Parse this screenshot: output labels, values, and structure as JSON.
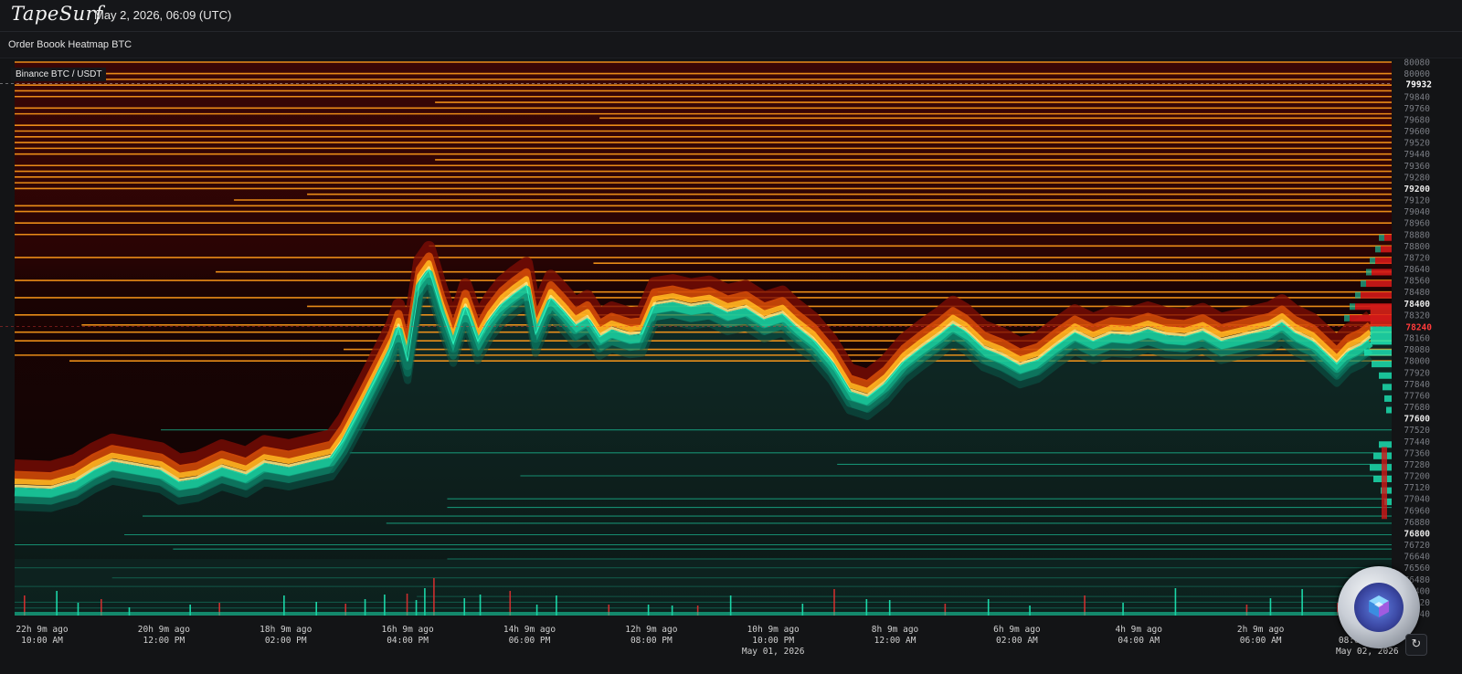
{
  "app": {
    "brand": "TapeSurf",
    "datetime": "May 2, 2026, 06:09 (UTC)"
  },
  "page": {
    "title": "Order Boook Heatmap BTC"
  },
  "chart_data": {
    "type": "heatmap",
    "title": "Binance BTC / USDT",
    "ylim": [
      76240,
      80080
    ],
    "y_ticks": [
      {
        "v": 80080,
        "label": "80080",
        "bold": false
      },
      {
        "v": 80000,
        "label": "80000",
        "bold": false
      },
      {
        "v": 79840,
        "label": "79840",
        "bold": false
      },
      {
        "v": 79760,
        "label": "79760",
        "bold": false
      },
      {
        "v": 79680,
        "label": "79680",
        "bold": false
      },
      {
        "v": 79600,
        "label": "79600",
        "bold": false
      },
      {
        "v": 79520,
        "label": "79520",
        "bold": false
      },
      {
        "v": 79440,
        "label": "79440",
        "bold": false
      },
      {
        "v": 79360,
        "label": "79360",
        "bold": false
      },
      {
        "v": 79280,
        "label": "79280",
        "bold": false
      },
      {
        "v": 79200,
        "label": "79200",
        "bold": true
      },
      {
        "v": 79120,
        "label": "79120",
        "bold": false
      },
      {
        "v": 79040,
        "label": "79040",
        "bold": false
      },
      {
        "v": 78960,
        "label": "78960",
        "bold": false
      },
      {
        "v": 78880,
        "label": "78880",
        "bold": false
      },
      {
        "v": 78800,
        "label": "78800",
        "bold": false
      },
      {
        "v": 78720,
        "label": "78720",
        "bold": false
      },
      {
        "v": 78640,
        "label": "78640",
        "bold": false
      },
      {
        "v": 78560,
        "label": "78560",
        "bold": false
      },
      {
        "v": 78480,
        "label": "78480",
        "bold": false
      },
      {
        "v": 78400,
        "label": "78400",
        "bold": true
      },
      {
        "v": 78320,
        "label": "78320",
        "bold": false
      },
      {
        "v": 78160,
        "label": "78160",
        "bold": false
      },
      {
        "v": 78080,
        "label": "78080",
        "bold": false
      },
      {
        "v": 78000,
        "label": "78000",
        "bold": false
      },
      {
        "v": 77920,
        "label": "77920",
        "bold": false
      },
      {
        "v": 77840,
        "label": "77840",
        "bold": false
      },
      {
        "v": 77760,
        "label": "77760",
        "bold": false
      },
      {
        "v": 77680,
        "label": "77680",
        "bold": false
      },
      {
        "v": 77600,
        "label": "77600",
        "bold": true
      },
      {
        "v": 77520,
        "label": "77520",
        "bold": false
      },
      {
        "v": 77440,
        "label": "77440",
        "bold": false
      },
      {
        "v": 77360,
        "label": "77360",
        "bold": false
      },
      {
        "v": 77280,
        "label": "77280",
        "bold": false
      },
      {
        "v": 77200,
        "label": "77200",
        "bold": false
      },
      {
        "v": 77120,
        "label": "77120",
        "bold": false
      },
      {
        "v": 77040,
        "label": "77040",
        "bold": false
      },
      {
        "v": 76960,
        "label": "76960",
        "bold": false
      },
      {
        "v": 76880,
        "label": "76880",
        "bold": false
      },
      {
        "v": 76800,
        "label": "76800",
        "bold": true
      },
      {
        "v": 76720,
        "label": "76720",
        "bold": false
      },
      {
        "v": 76640,
        "label": "76640",
        "bold": false
      },
      {
        "v": 76560,
        "label": "76560",
        "bold": false
      },
      {
        "v": 76480,
        "label": "76480",
        "bold": false
      },
      {
        "v": 76400,
        "label": "76400",
        "bold": false
      },
      {
        "v": 76320,
        "label": "76320",
        "bold": false
      },
      {
        "v": 76240,
        "label": "76240",
        "bold": false
      }
    ],
    "price_markers": [
      {
        "v": 79932,
        "label": "79932",
        "color": "#ffffff"
      },
      {
        "v": 78240,
        "label": "78240",
        "color": "#ff3b3b"
      }
    ],
    "x_ticks": [
      {
        "h": -22.15,
        "line1": "22h 9m ago",
        "line2": "10:00 AM",
        "line3": ""
      },
      {
        "h": -20.15,
        "line1": "20h 9m ago",
        "line2": "12:00 PM",
        "line3": ""
      },
      {
        "h": -18.15,
        "line1": "18h 9m ago",
        "line2": "02:00 PM",
        "line3": ""
      },
      {
        "h": -16.15,
        "line1": "16h 9m ago",
        "line2": "04:00 PM",
        "line3": ""
      },
      {
        "h": -14.15,
        "line1": "14h 9m ago",
        "line2": "06:00 PM",
        "line3": ""
      },
      {
        "h": -12.15,
        "line1": "12h 9m ago",
        "line2": "08:00 PM",
        "line3": ""
      },
      {
        "h": -10.15,
        "line1": "10h 9m ago",
        "line2": "10:00 PM",
        "line3": "May 01, 2026"
      },
      {
        "h": -8.15,
        "line1": "8h 9m ago",
        "line2": "12:00 AM",
        "line3": ""
      },
      {
        "h": -6.15,
        "line1": "6h 9m ago",
        "line2": "02:00 AM",
        "line3": ""
      },
      {
        "h": -4.15,
        "line1": "4h 9m ago",
        "line2": "04:00 AM",
        "line3": ""
      },
      {
        "h": -2.15,
        "line1": "2h 9m ago",
        "line2": "06:00 AM",
        "line3": ""
      },
      {
        "h": -0.4,
        "line1": "",
        "line2": "08:09:00 AM",
        "line3": "May 02, 2026"
      },
      {
        "h": 0,
        "line1": "now",
        "line2": "",
        "line3": ""
      }
    ],
    "price_series": [
      [
        -22.6,
        77130
      ],
      [
        -22.0,
        77120
      ],
      [
        -21.6,
        77170
      ],
      [
        -21.3,
        77250
      ],
      [
        -21.0,
        77310
      ],
      [
        -20.6,
        77280
      ],
      [
        -20.2,
        77250
      ],
      [
        -19.9,
        77170
      ],
      [
        -19.6,
        77190
      ],
      [
        -19.2,
        77270
      ],
      [
        -18.8,
        77220
      ],
      [
        -18.5,
        77300
      ],
      [
        -18.1,
        77270
      ],
      [
        -17.7,
        77310
      ],
      [
        -17.4,
        77340
      ],
      [
        -17.2,
        77460
      ],
      [
        -16.9,
        77700
      ],
      [
        -16.6,
        77950
      ],
      [
        -16.4,
        78120
      ],
      [
        -16.3,
        78250
      ],
      [
        -16.15,
        78010
      ],
      [
        -15.95,
        78560
      ],
      [
        -15.8,
        78650
      ],
      [
        -15.6,
        78370
      ],
      [
        -15.4,
        78130
      ],
      [
        -15.2,
        78390
      ],
      [
        -15.0,
        78150
      ],
      [
        -14.8,
        78300
      ],
      [
        -14.6,
        78410
      ],
      [
        -14.4,
        78480
      ],
      [
        -14.2,
        78540
      ],
      [
        -14.05,
        78200
      ],
      [
        -13.8,
        78450
      ],
      [
        -13.6,
        78360
      ],
      [
        -13.4,
        78260
      ],
      [
        -13.2,
        78310
      ],
      [
        -13.0,
        78180
      ],
      [
        -12.8,
        78230
      ],
      [
        -12.5,
        78190
      ],
      [
        -12.3,
        78200
      ],
      [
        -12.1,
        78400
      ],
      [
        -11.8,
        78420
      ],
      [
        -11.5,
        78390
      ],
      [
        -11.2,
        78410
      ],
      [
        -10.9,
        78350
      ],
      [
        -10.6,
        78380
      ],
      [
        -10.3,
        78300
      ],
      [
        -10.0,
        78340
      ],
      [
        -9.8,
        78260
      ],
      [
        -9.5,
        78160
      ],
      [
        -9.2,
        78010
      ],
      [
        -8.9,
        77800
      ],
      [
        -8.6,
        77760
      ],
      [
        -8.3,
        77860
      ],
      [
        -8.0,
        78010
      ],
      [
        -7.7,
        78110
      ],
      [
        -7.4,
        78200
      ],
      [
        -7.2,
        78270
      ],
      [
        -7.0,
        78220
      ],
      [
        -6.7,
        78100
      ],
      [
        -6.4,
        78050
      ],
      [
        -6.1,
        77980
      ],
      [
        -5.8,
        78020
      ],
      [
        -5.5,
        78120
      ],
      [
        -5.2,
        78210
      ],
      [
        -4.9,
        78150
      ],
      [
        -4.6,
        78200
      ],
      [
        -4.3,
        78190
      ],
      [
        -4.0,
        78230
      ],
      [
        -3.7,
        78190
      ],
      [
        -3.4,
        78180
      ],
      [
        -3.1,
        78220
      ],
      [
        -2.8,
        78150
      ],
      [
        -2.5,
        78180
      ],
      [
        -2.2,
        78210
      ],
      [
        -2.0,
        78230
      ],
      [
        -1.8,
        78280
      ],
      [
        -1.6,
        78210
      ],
      [
        -1.3,
        78150
      ],
      [
        -1.1,
        78070
      ],
      [
        -0.9,
        77990
      ],
      [
        -0.7,
        78080
      ],
      [
        -0.5,
        78120
      ],
      [
        -0.35,
        78170
      ]
    ],
    "ask_walls": [
      [
        80080,
        -22.6
      ],
      [
        80000,
        -22.6
      ],
      [
        79960,
        -22.6
      ],
      [
        79920,
        -22.6
      ],
      [
        79880,
        -22.6
      ],
      [
        79840,
        -22.6
      ],
      [
        79800,
        -15.7
      ],
      [
        79760,
        -22.6
      ],
      [
        79720,
        -22.6
      ],
      [
        79690,
        -13.0
      ],
      [
        79640,
        -22.6
      ],
      [
        79600,
        -22.6
      ],
      [
        79560,
        -22.6
      ],
      [
        79520,
        -22.6
      ],
      [
        79480,
        -22.6
      ],
      [
        79440,
        -22.6
      ],
      [
        79400,
        -15.7
      ],
      [
        79360,
        -22.6
      ],
      [
        79320,
        -22.6
      ],
      [
        79280,
        -22.6
      ],
      [
        79240,
        -22.6
      ],
      [
        79200,
        -22.6
      ],
      [
        79160,
        -17.8
      ],
      [
        79120,
        -19.0
      ],
      [
        79080,
        -22.6
      ],
      [
        79040,
        -22.6
      ],
      [
        78960,
        -22.6
      ],
      [
        78880,
        -22.6
      ],
      [
        78800,
        -15.8
      ],
      [
        78720,
        -22.6
      ],
      [
        78680,
        -13.1
      ],
      [
        78620,
        -19.3
      ],
      [
        78560,
        -22.6
      ],
      [
        78480,
        -15.8
      ],
      [
        78440,
        -22.6
      ],
      [
        78380,
        -17.8
      ],
      [
        78320,
        -22.6
      ],
      [
        78250,
        -21.5
      ],
      [
        78200,
        -22.6
      ],
      [
        78140,
        -22.6
      ],
      [
        78080,
        -17.2
      ],
      [
        78040,
        -22.6
      ],
      [
        78000,
        -21.7
      ]
    ],
    "bid_walls": [
      [
        77520,
        -20.2
      ],
      [
        77360,
        -17.1
      ],
      [
        77280,
        -9.1
      ],
      [
        77200,
        -14.3
      ],
      [
        77040,
        -15.5
      ],
      [
        76980,
        -15.5
      ],
      [
        76920,
        -20.5
      ],
      [
        76870,
        -16.5
      ],
      [
        76790,
        -20.8
      ],
      [
        76720,
        -22.6
      ],
      [
        76690,
        -20.0
      ],
      [
        76620,
        -15.5
      ],
      [
        76560,
        -22.6
      ],
      [
        76490,
        -21.0
      ],
      [
        76430,
        -22.6
      ],
      [
        76360,
        -16.0
      ],
      [
        76320,
        -22.6
      ],
      [
        76280,
        -22.6
      ]
    ],
    "volume_bars": [
      [
        -22.45,
        22
      ],
      [
        -21.92,
        27
      ],
      [
        -21.57,
        14
      ],
      [
        -21.19,
        18
      ],
      [
        -20.73,
        9
      ],
      [
        -19.73,
        12
      ],
      [
        -19.25,
        14
      ],
      [
        -18.19,
        22
      ],
      [
        -17.66,
        15
      ],
      [
        -17.18,
        13
      ],
      [
        -16.86,
        18
      ],
      [
        -16.54,
        23
      ],
      [
        -16.17,
        24
      ],
      [
        -16.02,
        17
      ],
      [
        -15.88,
        30
      ],
      [
        -15.73,
        41
      ],
      [
        -15.23,
        19
      ],
      [
        -14.97,
        23
      ],
      [
        -14.48,
        27
      ],
      [
        -14.04,
        12
      ],
      [
        -13.72,
        22
      ],
      [
        -12.86,
        12
      ],
      [
        -12.21,
        12
      ],
      [
        -11.82,
        11
      ],
      [
        -11.4,
        11
      ],
      [
        -10.86,
        22
      ],
      [
        -9.68,
        13
      ],
      [
        -9.16,
        29
      ],
      [
        -8.63,
        18
      ],
      [
        -8.25,
        17
      ],
      [
        -7.34,
        13
      ],
      [
        -6.63,
        18
      ],
      [
        -5.95,
        11
      ],
      [
        -5.05,
        22
      ],
      [
        -4.42,
        14
      ],
      [
        -3.56,
        30
      ],
      [
        -2.39,
        12
      ],
      [
        -2.0,
        19
      ],
      [
        -1.48,
        29
      ],
      [
        -0.9,
        14
      ],
      [
        -0.4,
        18
      ],
      [
        -0.1,
        21
      ]
    ],
    "xlim_hours": [
      -22.6,
      0
    ],
    "grid": false,
    "colors": {
      "low": "#8b0000",
      "mid": "#ff8c00",
      "high": "#ffd700",
      "bid": "#1de9b6",
      "ask_profile": "#d01818",
      "bid_profile": "#1de9b6"
    }
  },
  "controls": {
    "refresh_icon": "↻"
  },
  "branding": {
    "logo": "silver coin with blue cube emblem"
  }
}
